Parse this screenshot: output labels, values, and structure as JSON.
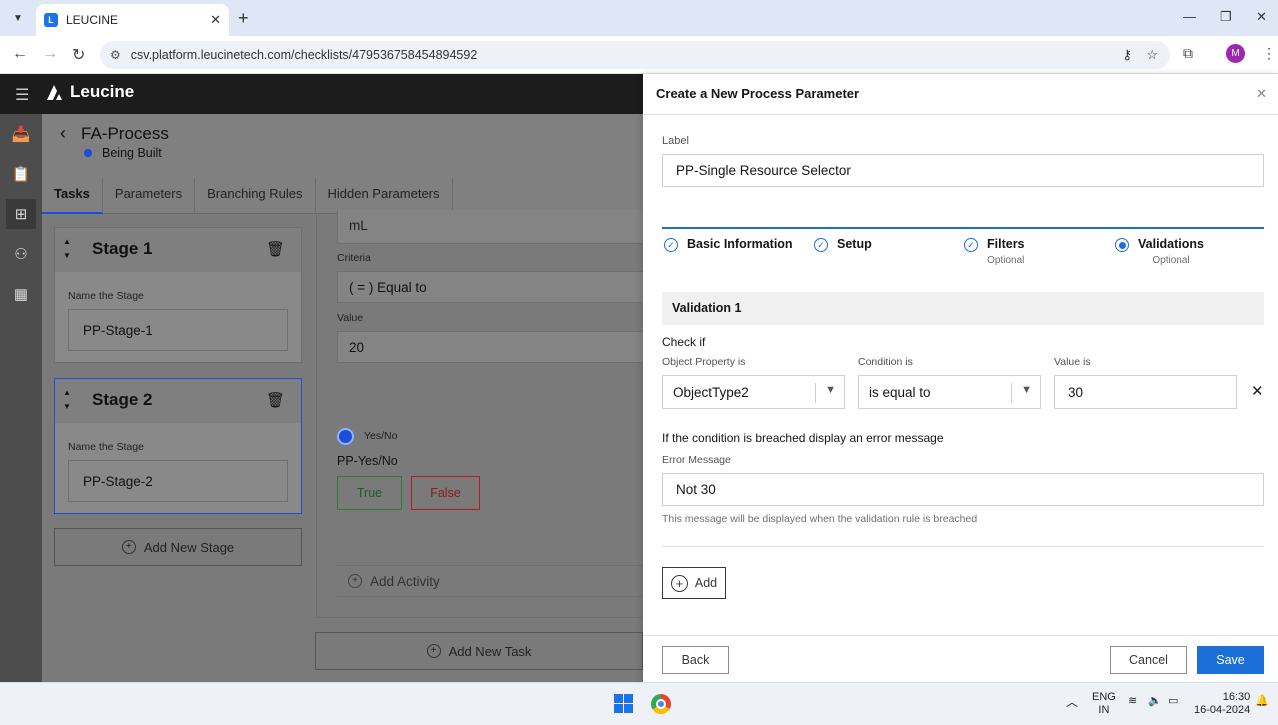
{
  "browser": {
    "tab_title": "LEUCINE",
    "url": "csv.platform.leucinetech.com/checklists/479536758454894592",
    "profile_initial": "M"
  },
  "app": {
    "brand": "Leucine",
    "process": {
      "title": "FA-Process",
      "status": "Being Built"
    },
    "tabs": [
      "Tasks",
      "Parameters",
      "Branching Rules",
      "Hidden Parameters"
    ],
    "stages": [
      {
        "title": "Stage 1",
        "name_label": "Name the Stage",
        "name_value": "PP-Stage-1"
      },
      {
        "title": "Stage 2",
        "name_label": "Name the Stage",
        "name_value": "PP-Stage-2"
      }
    ],
    "add_stage_label": "Add New Stage",
    "task": {
      "partial_unit": "mL",
      "criteria_label": "Criteria",
      "criteria_value": "( = ) Equal to",
      "value_label": "Value",
      "value_value": "20",
      "yesno_tag": "Yes/No",
      "yesno_name": "PP-Yes/No",
      "true_label": "True",
      "false_label": "False",
      "add_activity_label": "Add Activity"
    },
    "add_task_label": "Add New Task"
  },
  "drawer": {
    "title": "Create a New Process Parameter",
    "label_caption": "Label",
    "label_value": "PP-Single Resource Selector",
    "steps": [
      {
        "label": "Basic Information",
        "sub": "",
        "state": "done"
      },
      {
        "label": "Setup",
        "sub": "",
        "state": "done"
      },
      {
        "label": "Filters",
        "sub": "Optional",
        "state": "done"
      },
      {
        "label": "Validations",
        "sub": "Optional",
        "state": "current"
      }
    ],
    "validation": {
      "heading": "Validation 1",
      "check_if": "Check if",
      "object_property_label": "Object Property is",
      "object_property_value": "ObjectType2",
      "condition_label": "Condition is",
      "condition_value": "is equal to",
      "value_label": "Value is",
      "value_value": "30",
      "breach_text": "If the condition is breached display an error message",
      "error_label": "Error Message",
      "error_value": "Not 30",
      "helper_text": "This message will be displayed when the validation rule is breached"
    },
    "add_label": "Add",
    "back_label": "Back",
    "cancel_label": "Cancel",
    "save_label": "Save"
  },
  "taskbar": {
    "lang_top": "ENG",
    "lang_bottom": "IN",
    "time": "16:30",
    "date": "16-04-2024"
  },
  "colors": {
    "primary": "#1d6fd8",
    "status_dot": "#1d4ed8"
  }
}
